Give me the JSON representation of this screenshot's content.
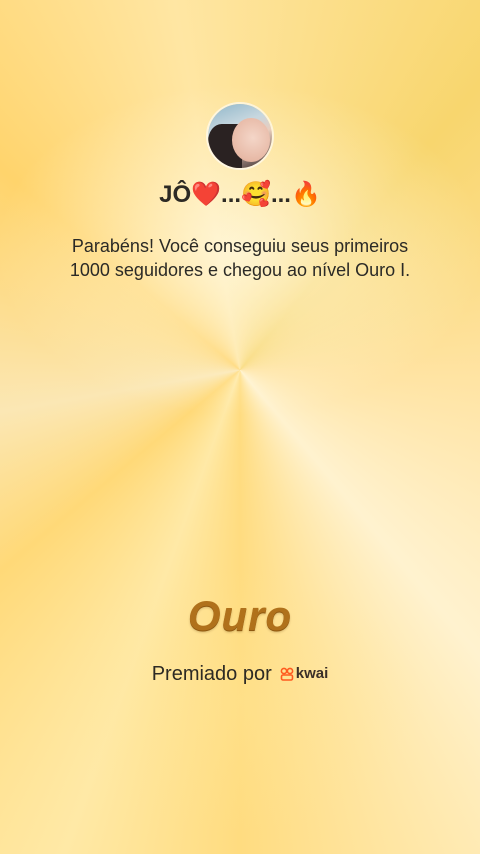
{
  "profile": {
    "username": "JÔ❤️...🥰...🔥"
  },
  "message": "Parabéns! Você conseguiu seus primeiros 1000 seguidores e chegou ao nível Ouro I.",
  "level": {
    "title": "Ouro"
  },
  "sponsor": {
    "label": "Premiado por",
    "brand": "kwai",
    "brand_color": "#ff5a1f"
  },
  "colors": {
    "level_title": "#b0711b",
    "text": "#2d2a24"
  }
}
